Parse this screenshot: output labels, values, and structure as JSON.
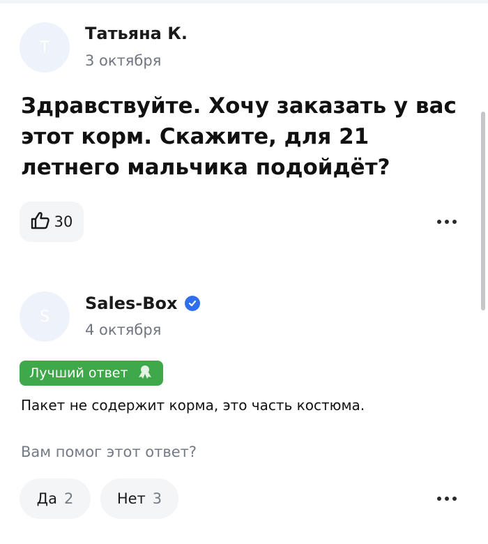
{
  "question": {
    "author": "Татьяна К.",
    "avatar_letter": "Т",
    "date": "3 октября",
    "text": "Здравствуйте. Хочу заказать у вас этот корм. Скажите, для 21 летнего мальчика подойдёт?",
    "likes": "30",
    "like_icon": "thumbs-up-icon",
    "more_icon": "more-dots-icon"
  },
  "answer": {
    "author": "Sales-Box",
    "avatar_letter": "S",
    "verified_icon": "verified-check-icon",
    "date": "4 октября",
    "best_label": "Лучший ответ",
    "best_icon": "award-ribbon-icon",
    "text": "Пакет не содержит корма, это часть костюма.",
    "helpful_question": "Вам помог этот ответ?",
    "yes_label": "Да",
    "yes_count": "2",
    "no_label": "Нет",
    "no_count": "3",
    "more_icon": "more-dots-icon"
  },
  "colors": {
    "best_badge": "#3ea84a",
    "verified": "#2f6fed",
    "avatar_bg": "#eef3fb",
    "button_bg": "#f4f5f7",
    "muted_text": "#737a85"
  }
}
